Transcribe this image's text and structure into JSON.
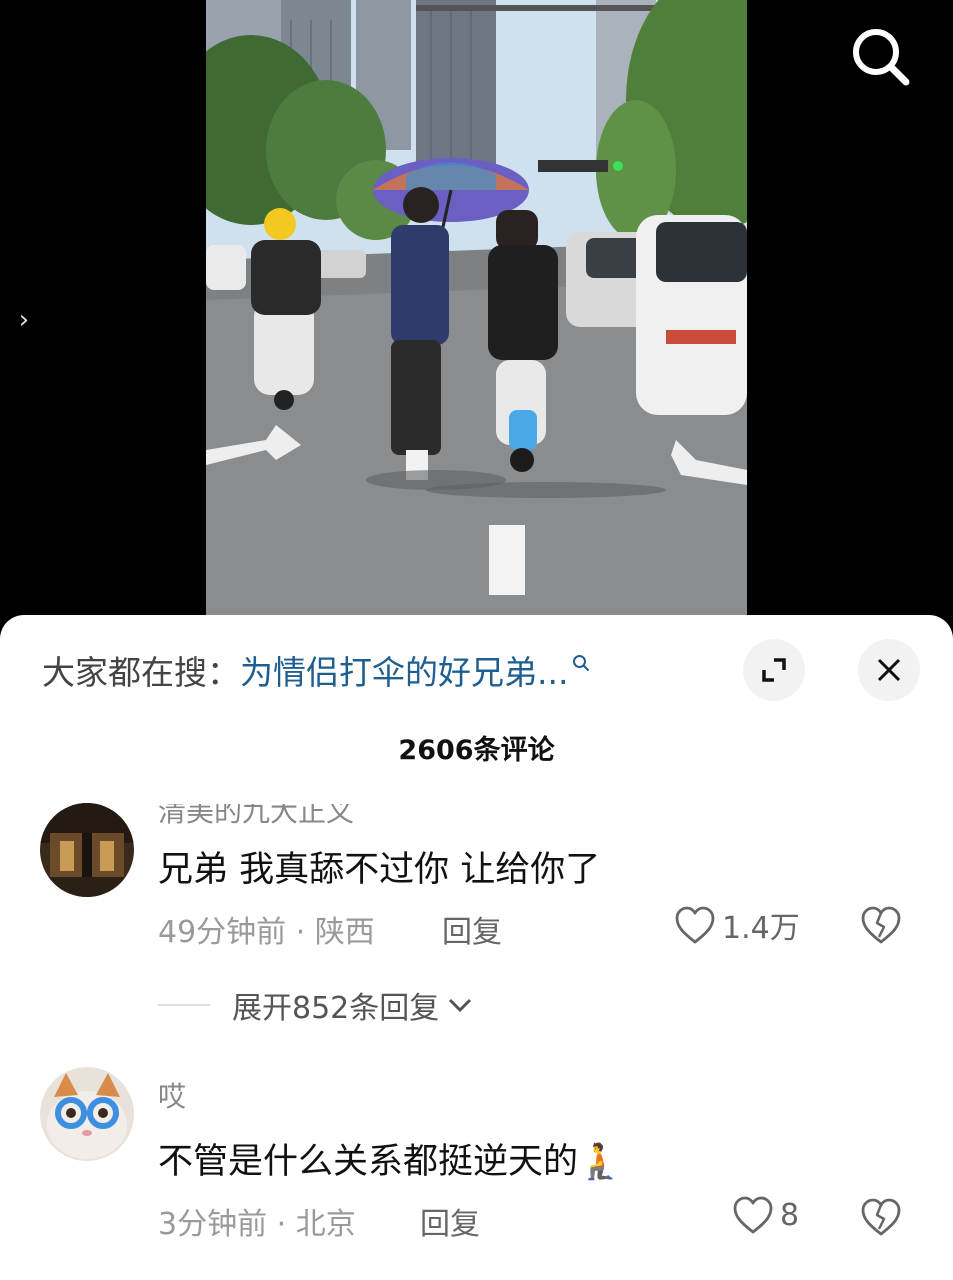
{
  "video": {
    "search_icon": "search-icon",
    "side_arrow_icon": "chevron-right-icon"
  },
  "sheet": {
    "hot_search_label": "大家都在搜：",
    "hot_search_query": "为情侣打伞的好兄弟...",
    "expand_icon": "expand-icon",
    "close_icon": "close-icon",
    "comment_count": "2606条评论"
  },
  "comments": [
    {
      "username": "清美的九大正义",
      "text": "兄弟 我真舔不过你 让给你了",
      "time": "49分钟前",
      "location": "陕西",
      "reply_label": "回复",
      "likes": "1.4万",
      "expand_replies": "展开852条回复"
    },
    {
      "username": "哎",
      "text": "不管是什么关系都挺逆天的",
      "emoji": "🧎",
      "time": "3分钟前",
      "location": "北京",
      "reply_label": "回复",
      "likes": "8"
    }
  ],
  "colors": {
    "query_blue": "#1f5f8f",
    "meta_gray": "#9a9a9a"
  }
}
